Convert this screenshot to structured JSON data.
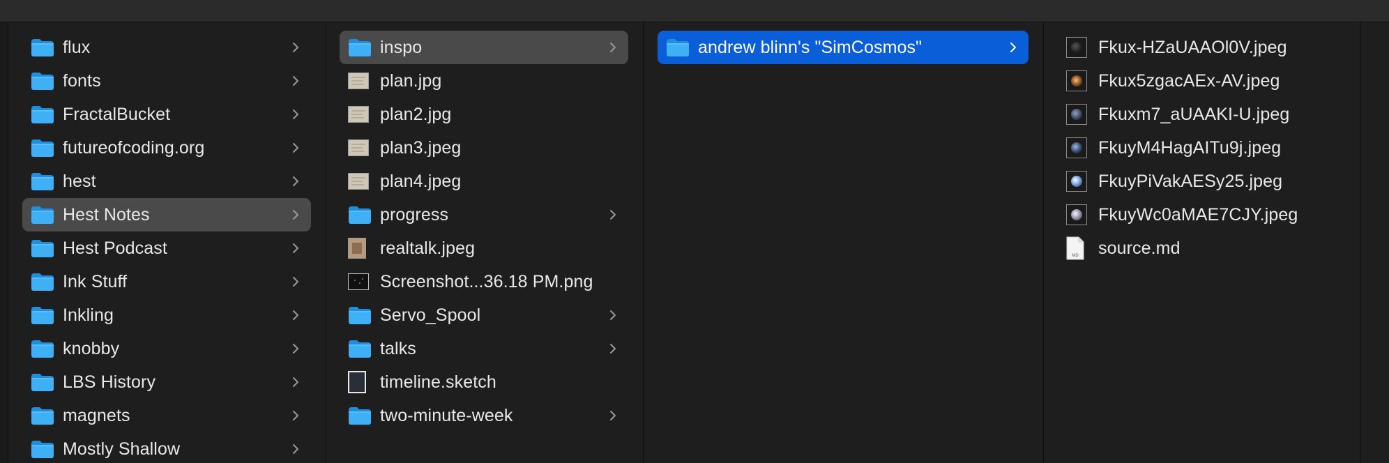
{
  "window": {
    "title": ""
  },
  "columns": [
    {
      "items": [
        {
          "label": "flux",
          "kind": "folder"
        },
        {
          "label": "fonts",
          "kind": "folder"
        },
        {
          "label": "FractalBucket",
          "kind": "folder"
        },
        {
          "label": "futureofcoding.org",
          "kind": "folder"
        },
        {
          "label": "hest",
          "kind": "folder"
        },
        {
          "label": "Hest Notes",
          "kind": "folder",
          "selected": "gray"
        },
        {
          "label": "Hest Podcast",
          "kind": "folder"
        },
        {
          "label": "Ink Stuff",
          "kind": "folder"
        },
        {
          "label": "Inkling",
          "kind": "folder"
        },
        {
          "label": "knobby",
          "kind": "folder"
        },
        {
          "label": "LBS History",
          "kind": "folder"
        },
        {
          "label": "magnets",
          "kind": "folder"
        },
        {
          "label": "Mostly Shallow",
          "kind": "folder"
        }
      ]
    },
    {
      "items": [
        {
          "label": "inspo",
          "kind": "folder",
          "selected": "gray"
        },
        {
          "label": "plan.jpg",
          "kind": "image"
        },
        {
          "label": "plan2.jpg",
          "kind": "image"
        },
        {
          "label": "plan3.jpeg",
          "kind": "image"
        },
        {
          "label": "plan4.jpeg",
          "kind": "image"
        },
        {
          "label": "progress",
          "kind": "folder"
        },
        {
          "label": "realtalk.jpeg",
          "kind": "image-portrait"
        },
        {
          "label": "Screenshot...36.18 PM.png",
          "kind": "image-dark"
        },
        {
          "label": "Servo_Spool",
          "kind": "folder"
        },
        {
          "label": "talks",
          "kind": "folder"
        },
        {
          "label": "timeline.sketch",
          "kind": "sketch"
        },
        {
          "label": "two-minute-week",
          "kind": "folder"
        }
      ]
    },
    {
      "items": [
        {
          "label": "andrew blinn's \"SimCosmos\"",
          "kind": "folder",
          "selected": "blue"
        }
      ]
    },
    {
      "items": [
        {
          "label": "Fkux-HZaUAAOl0V.jpeg",
          "kind": "space-image"
        },
        {
          "label": "Fkux5zgacAEx-AV.jpeg",
          "kind": "space-image"
        },
        {
          "label": "Fkuxm7_aUAAKI-U.jpeg",
          "kind": "space-image"
        },
        {
          "label": "FkuyM4HagAITu9j.jpeg",
          "kind": "space-image"
        },
        {
          "label": "FkuyPiVakAESy25.jpeg",
          "kind": "space-image"
        },
        {
          "label": "FkuyWc0aMAE7CJY.jpeg",
          "kind": "space-image"
        },
        {
          "label": "source.md",
          "kind": "md"
        }
      ]
    }
  ],
  "icons": {
    "folder": "folder-icon",
    "chevron": "chevron-right-icon",
    "image": "image-thumbnail-icon",
    "md": "markdown-file-icon",
    "sketch": "sketch-file-icon"
  },
  "md_badge": "MD",
  "colors": {
    "background": "#1e1e1e",
    "selection_blue": "#0a5fd8",
    "selection_gray": "#4a4a4a",
    "folder_blue": "#2aa3f0"
  }
}
